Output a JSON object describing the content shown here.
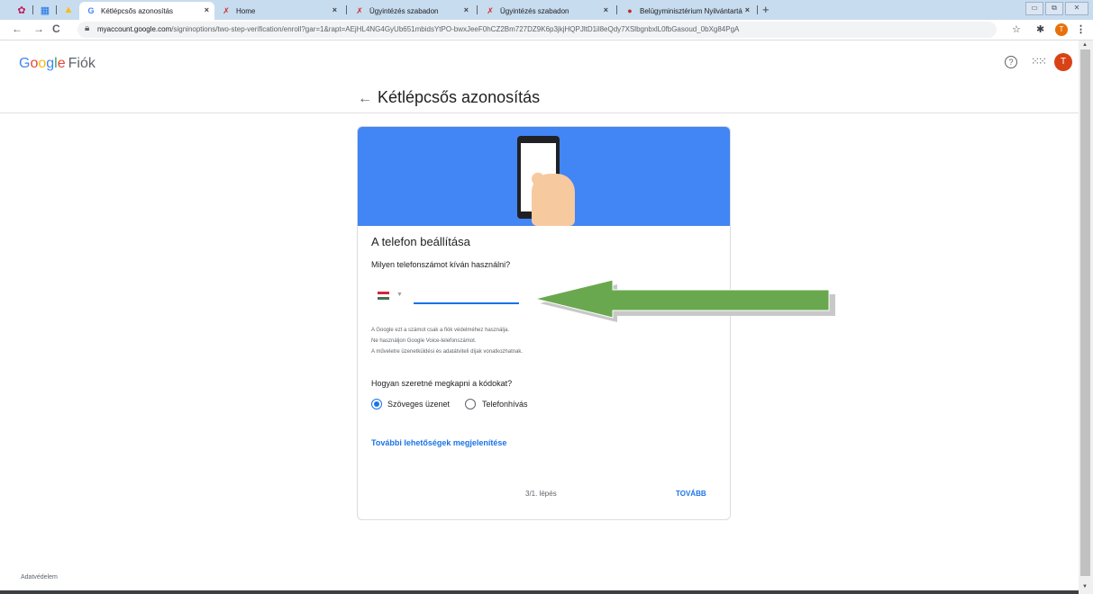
{
  "tabs": [
    {
      "label": "Kétlépcsős azonosítás",
      "icon": "google-g-icon",
      "active": true
    },
    {
      "label": "Home",
      "icon": "ugy-logo-icon",
      "active": false
    },
    {
      "label": "Ügyintézés szabadon",
      "icon": "ugy-logo-icon",
      "active": false
    },
    {
      "label": "Ügyintézés szabadon",
      "icon": "ugy-logo-icon",
      "active": false
    },
    {
      "label": "Belügyminisztérium Nyilvántartá",
      "icon": "bm-icon",
      "active": false
    }
  ],
  "tab_close": "×",
  "new_tab": "+",
  "toolbar": {
    "back": "←",
    "forward": "→",
    "reload": "C",
    "url_host": "myaccount.google.com",
    "url_path": "/signinoptions/two-step-verification/enroll?gar=1&rapt=AEjHL4NG4GyUb651mbidsYtPO-bwxJeeF0hCZ2Bm727DZ9K6p3jkjHQPJltD1il8eQdy7XSlbgnbxlL0fbGasoud_0bXg84PgA",
    "avatar_initial": "T"
  },
  "header": {
    "logo_letters": [
      "G",
      "o",
      "o",
      "g",
      "l",
      "e"
    ],
    "product": "Fiók",
    "avatar_initial": "T"
  },
  "page": {
    "back_arrow": "←",
    "title": "Kétlépcsős azonosítás"
  },
  "card": {
    "heading": "A telefon beállítása",
    "phone_question": "Milyen telefonszámot kíván használni?",
    "phone_value": "",
    "info_lines": [
      "A Google ezt a számot csak a fiók védelméhez használja.",
      "Ne használjon Google Voice-telefonszámot.",
      "A műveletre üzenetküldési és adatátviteli díjak vonatkozhatnak."
    ],
    "codes_question": "Hogyan szeretné megkapni a kódokat?",
    "options": [
      {
        "label": "Szöveges üzenet",
        "selected": true
      },
      {
        "label": "Telefonhívás",
        "selected": false
      }
    ],
    "more_link": "További lehetőségek megjelenítése",
    "step": "3/1. lépés",
    "next": "TOVÁBB"
  },
  "footer": {
    "privacy": "Adatvédelem"
  },
  "colors": {
    "banner": "#4285f4",
    "link": "#1a73e8",
    "annotation_arrow": "#6aa84f"
  }
}
